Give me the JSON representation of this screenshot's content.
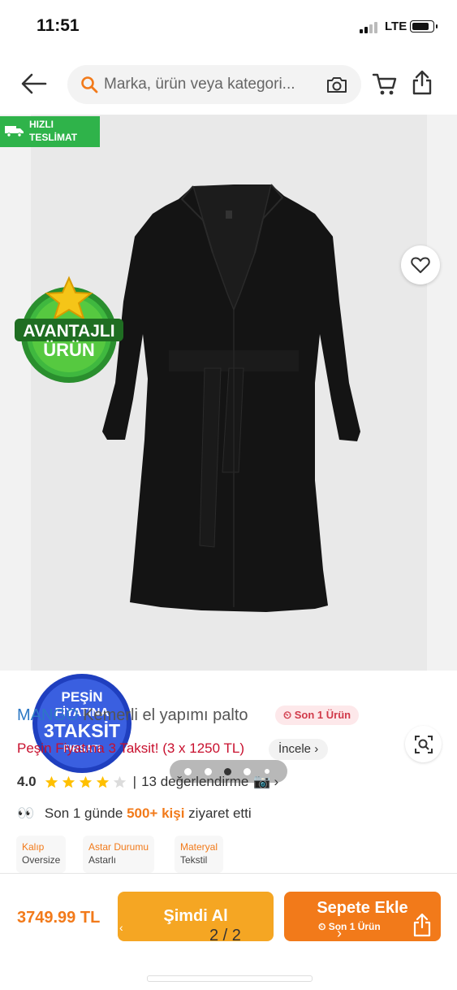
{
  "status": {
    "time": "11:51",
    "network": "LTE"
  },
  "search": {
    "placeholder": "Marka, ürün veya kategori..."
  },
  "gallery": {
    "fast_delivery": [
      "HIZLI",
      "TESLİMAT"
    ],
    "badge_advantage": [
      "AVANTAJLI",
      "ÜRÜN"
    ],
    "badge_installment": [
      "PEŞİN",
      "FİYATINA",
      "3TAKSİT",
      "FIRSATI"
    ],
    "active_dot": 3,
    "dot_count": 5
  },
  "product": {
    "brand": "MANGO",
    "name": "Kemerli el yapımı palto",
    "stock_badge": "Son 1 Ürün",
    "installment_text": "Peşin Fiyatına 3 Taksit! (3 x 1250 TL)",
    "installment_link": "İncele",
    "rating": "4.0",
    "rating_value": 4,
    "review_count": "13 değerlendirme",
    "visit_prefix": "Son 1 günde",
    "visit_highlight": "500+ kişi",
    "visit_suffix": "ziyaret etti"
  },
  "attributes": [
    {
      "key": "Kalıp",
      "value": "Oversize"
    },
    {
      "key": "Astar Durumu",
      "value": "Astarlı"
    },
    {
      "key": "Materyal",
      "value": "Tekstil"
    }
  ],
  "bottom": {
    "price": "3749.99 TL",
    "buy_now": "Şimdi Al",
    "add_to_cart": "Sepete Ekle",
    "add_to_cart_sub": "Son 1 Ürün",
    "pager": "2 / 2"
  },
  "colors": {
    "accent": "#f27a1a",
    "buy_now": "#f5a623",
    "brand": "#2d78c4",
    "installment": "#c8102e",
    "fast_green": "#2fb34a"
  }
}
